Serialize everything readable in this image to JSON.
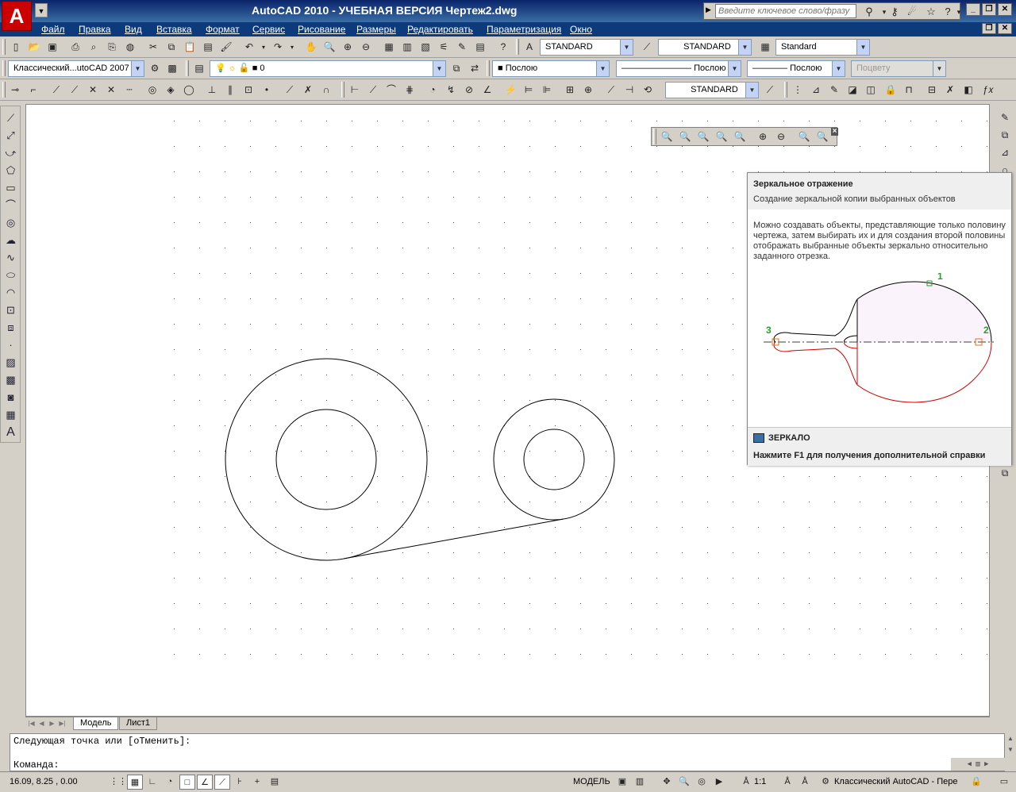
{
  "window": {
    "title": "AutoCAD 2010 - УЧЕБНАЯ ВЕРСИЯ    Чертеж2.dwg",
    "logo_letter": "A",
    "search_placeholder": "Введите ключевое слово/фразу"
  },
  "menu": [
    "Файл",
    "Правка",
    "Вид",
    "Вставка",
    "Формат",
    "Сервис",
    "Рисование",
    "Размеры",
    "Редактировать",
    "Параметризация",
    "Окно"
  ],
  "styles_toolbar": {
    "text_style": "STANDARD",
    "dim_style": "STANDARD",
    "table_style": "Standard"
  },
  "layers_toolbar": {
    "workspace": "Классический...utoCAD 2007",
    "layer": "0",
    "color": "Послою",
    "linetype": "Послою",
    "lineweight": "Послою",
    "plotstyle": "Поцвету"
  },
  "dim_toolbar": {
    "dim_style": "STANDARD"
  },
  "tooltip": {
    "title": "Зеркальное отражение",
    "subtitle": "Создание зеркальной копии выбранных объектов",
    "description": "Можно создавать объекты, представляющие только половину чертежа, затем выбирать их и для создания второй половины отображать выбранные объекты зеркально относительно заданного отрезка.",
    "point_labels": [
      "1",
      "2",
      "3"
    ],
    "command": "ЗЕРКАЛО",
    "help": "Нажмите F1 для получения дополнительной справки"
  },
  "tabs": [
    "Модель",
    "Лист1"
  ],
  "command_line": {
    "history": "Следующая точка или [оТменить]:",
    "prompt": "Команда:"
  },
  "status": {
    "coords": "16.09, 8.25 , 0.00",
    "model_label": "МОДЕЛЬ",
    "annotation_scale": "1:1",
    "workspace": "Классический AutoCAD - Пере"
  },
  "colors": {
    "title_bar": "#0a246a",
    "tooltip_mirror_red": "#cc0000",
    "tooltip_point_green": "#2a9d2a"
  }
}
